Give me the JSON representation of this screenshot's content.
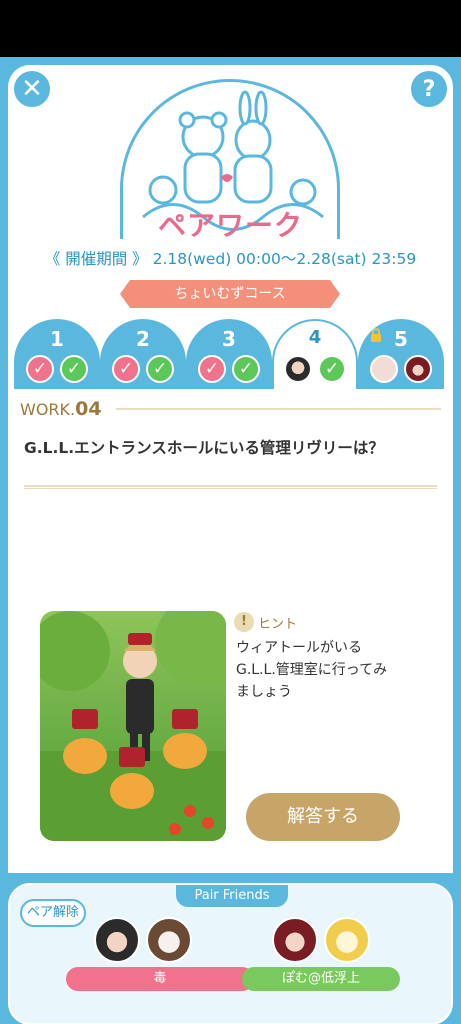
{
  "header": {
    "close_icon": "close-icon",
    "help_label": "?",
    "title": "ペアワーク",
    "period": "《 開催期間 》 2.18(wed) 00:00〜2.28(sat) 23:59",
    "course": "ちょいむずコース"
  },
  "tabs": [
    {
      "label": "1",
      "state": "done"
    },
    {
      "label": "2",
      "state": "done"
    },
    {
      "label": "3",
      "state": "done"
    },
    {
      "label": "4",
      "state": "active"
    },
    {
      "label": "5",
      "state": "locked"
    }
  ],
  "work": {
    "prefix": "WORK.",
    "number": "04",
    "question": "G.L.L.エントランスホールにいる管理リヴリーは？"
  },
  "hint": {
    "label": "ヒント",
    "text": "ウィアトールがいる\nG.L.L.管理室に行ってみ\nましょう"
  },
  "answer_button": "解答する",
  "pair": {
    "title": "Pair Friends",
    "unpair_label": "ペア解除",
    "friends": [
      {
        "name": "毒",
        "color": "#f0728c"
      },
      {
        "name": "ぽむ@低浮上",
        "color": "#7ac95e"
      }
    ]
  },
  "colors": {
    "accent_blue": "#5ab8de",
    "title_pink": "#e96a8c",
    "gold": "#c7a568",
    "coral": "#f4907a"
  }
}
